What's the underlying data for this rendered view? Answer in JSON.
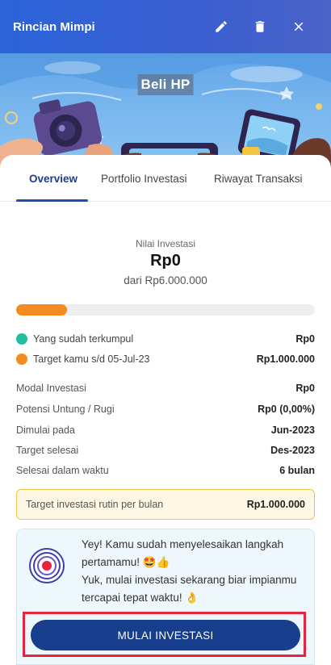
{
  "appbar": {
    "title": "Rincian Mimpi",
    "actions": [
      {
        "icon": "pencil-icon",
        "label": "edit"
      },
      {
        "icon": "trash-icon",
        "label": "delete"
      },
      {
        "icon": "close-icon",
        "label": "close"
      }
    ]
  },
  "hero": {
    "title": "Beli HP"
  },
  "tabs": [
    {
      "label": "Overview",
      "active": true
    },
    {
      "label": "Portfolio Investasi",
      "active": false
    },
    {
      "label": "Riwayat Transaksi",
      "active": false
    }
  ],
  "summary": {
    "label": "Nilai Investasi",
    "value": "Rp0",
    "of_target": "dari Rp6.000.000",
    "progress_fraction": 0.17
  },
  "legend": [
    {
      "label": "Yang sudah terkumpul",
      "value": "Rp0",
      "color": "#1fbf9f"
    },
    {
      "label": "Target kamu s/d 05-Jul-23",
      "value": "Rp1.000.000",
      "color": "#f28c1e"
    }
  ],
  "details": [
    {
      "label": "Modal Investasi",
      "value": "Rp0"
    },
    {
      "label": "Potensi Untung / Rugi",
      "value": "Rp0 (0,00%)"
    },
    {
      "label": "Dimulai pada",
      "value": "Jun-2023"
    },
    {
      "label": "Target selesai",
      "value": "Des-2023"
    },
    {
      "label": "Selesai dalam waktu",
      "value": "6 bulan"
    }
  ],
  "monthly_target": {
    "label": "Target investasi rutin per bulan",
    "value": "Rp1.000.000"
  },
  "notice": {
    "line1": "Yey! Kamu sudah menyelesaikan langkah",
    "line2": "pertamamu! 🤩👍",
    "line3": "Yuk, mulai investasi sekarang biar impianmu",
    "line4": "tercapai tepat waktu! 👌"
  },
  "cta": {
    "label": "MULAI INVESTASI"
  },
  "colors": {
    "brand": "#163e8c",
    "accent": "#f28c1e",
    "success": "#1fbf9f",
    "highlight": "#e3253d"
  }
}
